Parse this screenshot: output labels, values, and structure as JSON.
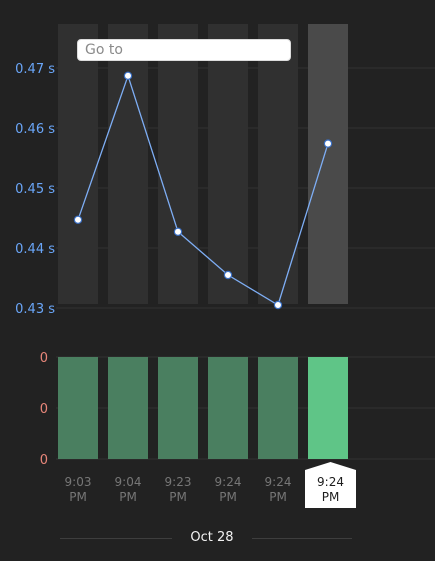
{
  "search": {
    "placeholder": "Go to"
  },
  "date_label": "Oct 28",
  "colors": {
    "background": "#222222",
    "column": "#303030",
    "column_selected": "#4a4a4a",
    "line": "#7eaef5",
    "axis_top": "#6aa6f8",
    "axis_bottom": "#e8867a",
    "bar": "#4a7f60",
    "bar_selected": "#5fc587",
    "time_label": "#777777"
  },
  "selected_index": 5,
  "chart_data": [
    {
      "type": "line",
      "categories": [
        "9:03 PM",
        "9:04 PM",
        "9:23 PM",
        "9:24 PM",
        "9:24 PM",
        "9:24 PM"
      ],
      "values": [
        0.4447,
        0.4687,
        0.4427,
        0.4355,
        0.4305,
        0.4574
      ],
      "unit": "s",
      "ylim": [
        0.426,
        0.4775
      ],
      "yticks": [
        0.43,
        0.44,
        0.45,
        0.46,
        0.47
      ],
      "ytick_labels": [
        "0.43 s",
        "0.44 s",
        "0.45 s",
        "0.46 s",
        "0.47 s"
      ],
      "grid": true
    },
    {
      "type": "bar",
      "categories": [
        "9:03 PM",
        "9:04 PM",
        "9:23 PM",
        "9:24 PM",
        "9:24 PM",
        "9:24 PM"
      ],
      "values": [
        0,
        0,
        0,
        0,
        0,
        0
      ],
      "ytick_labels": [
        "0",
        "0",
        "0"
      ],
      "grid": true
    }
  ]
}
